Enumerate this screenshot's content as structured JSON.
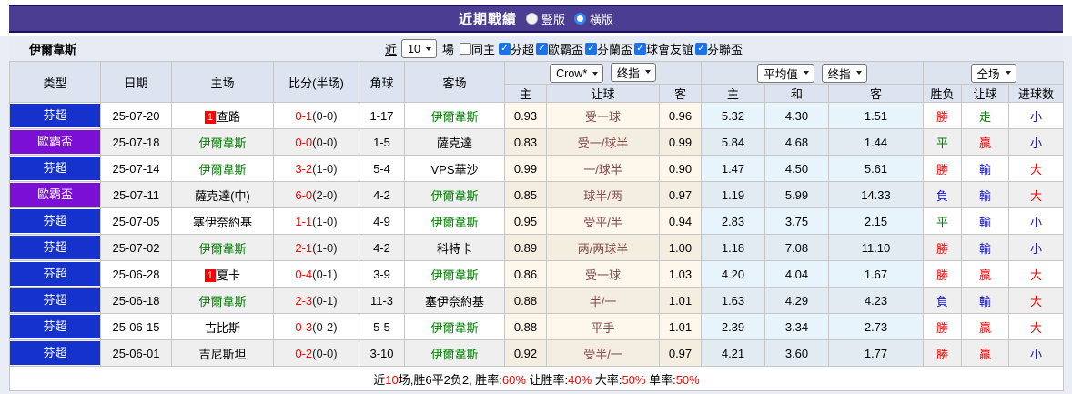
{
  "colors": {
    "accent_purple": "#4a3d92",
    "bar_border": "#1c1259",
    "league_blue": "#1532cd",
    "cup_purple": "#7c0fd6",
    "team_green": "#008000",
    "score_red": "#ff0000",
    "handicap_text": "#804a4a",
    "result_red": "#ff0000",
    "result_green": "#008000",
    "result_blue": "#1414d6",
    "odds_bg": "#fdf8eb",
    "avg_bg": "#e8f4fb",
    "header_bg": "#dde4f0",
    "filter_bg": "#e7ebf4",
    "page_bg": "#e9edf5",
    "row_alt_bg": "#efefef",
    "checkbox_blue": "#1a73e8",
    "radio_blue": "#2f81f7",
    "summary_red": "#ff0000"
  },
  "header": {
    "title": "近期戰績",
    "radio_vertical": "豎版",
    "radio_horizontal": "橫版",
    "selected": "橫版"
  },
  "filter": {
    "team": "伊爾韋斯",
    "near_label": "近",
    "match_count": "10",
    "games_label": "場",
    "same_home_label": "同主",
    "leagues": [
      "芬超",
      "歐霸盃",
      "芬蘭盃",
      "球會友誼",
      "芬聯盃"
    ]
  },
  "table": {
    "columns": {
      "type": "类型",
      "date": "日期",
      "home": "主场",
      "score": "比分(半场)",
      "corner": "角球",
      "away": "客场",
      "asian_home": "主",
      "asian_handicap": "让球",
      "asian_away": "客",
      "euro_home": "主",
      "euro_draw": "和",
      "euro_away": "客",
      "result": "胜负",
      "handicap_result": "让球",
      "goals": "进球数"
    },
    "selects": {
      "asian_company": "Crow*",
      "asian_type": "终指",
      "euro_company": "平均值",
      "euro_type": "终指",
      "scope": "全场"
    },
    "rows": [
      {
        "league": "芬超",
        "league_style": "blue",
        "date": "25-07-20",
        "home": {
          "name": "查路",
          "is_team": false,
          "redcard": "1"
        },
        "score": "0-1",
        "half": "(0-0)",
        "corner": "1-17",
        "away": {
          "name": "伊爾韋斯",
          "is_team": true
        },
        "asian": {
          "home": "0.93",
          "handicap": "受一球",
          "away": "0.96"
        },
        "euro": {
          "home": "5.32",
          "draw": "4.30",
          "away": "1.51"
        },
        "result": {
          "text": "勝",
          "color": "red"
        },
        "handicap_result": {
          "text": "走",
          "color": "green"
        },
        "goals": {
          "text": "小",
          "color": "blue"
        }
      },
      {
        "league": "歐霸盃",
        "league_style": "purple",
        "date": "25-07-18",
        "home": {
          "name": "伊爾韋斯",
          "is_team": true
        },
        "score": "0-0",
        "half": "(0-0)",
        "corner": "1-5",
        "away": {
          "name": "薩克達",
          "is_team": false
        },
        "asian": {
          "home": "0.83",
          "handicap": "受一/球半",
          "away": "0.99"
        },
        "euro": {
          "home": "5.84",
          "draw": "4.68",
          "away": "1.44"
        },
        "result": {
          "text": "平",
          "color": "green"
        },
        "handicap_result": {
          "text": "贏",
          "color": "red"
        },
        "goals": {
          "text": "小",
          "color": "blue"
        }
      },
      {
        "league": "芬超",
        "league_style": "blue",
        "date": "25-07-14",
        "home": {
          "name": "伊爾韋斯",
          "is_team": true
        },
        "score": "3-2",
        "half": "(1-0)",
        "corner": "5-4",
        "away": {
          "name": "VPS華沙",
          "is_team": false
        },
        "asian": {
          "home": "0.99",
          "handicap": "一/球半",
          "away": "0.90"
        },
        "euro": {
          "home": "1.47",
          "draw": "4.50",
          "away": "5.61"
        },
        "result": {
          "text": "勝",
          "color": "red"
        },
        "handicap_result": {
          "text": "輸",
          "color": "blue"
        },
        "goals": {
          "text": "大",
          "color": "red"
        }
      },
      {
        "league": "歐霸盃",
        "league_style": "purple",
        "date": "25-07-11",
        "home": {
          "name": "薩克達(中)",
          "is_team": false
        },
        "score": "6-0",
        "half": "(2-0)",
        "corner": "4-2",
        "away": {
          "name": "伊爾韋斯",
          "is_team": true
        },
        "asian": {
          "home": "0.85",
          "handicap": "球半/两",
          "away": "0.97"
        },
        "euro": {
          "home": "1.19",
          "draw": "5.99",
          "away": "14.33"
        },
        "result": {
          "text": "負",
          "color": "blue"
        },
        "handicap_result": {
          "text": "輸",
          "color": "blue"
        },
        "goals": {
          "text": "大",
          "color": "red"
        }
      },
      {
        "league": "芬超",
        "league_style": "blue",
        "date": "25-07-05",
        "home": {
          "name": "塞伊奈約基",
          "is_team": false
        },
        "score": "1-1",
        "half": "(1-0)",
        "corner": "4-9",
        "away": {
          "name": "伊爾韋斯",
          "is_team": true
        },
        "asian": {
          "home": "0.95",
          "handicap": "受平/半",
          "away": "0.94"
        },
        "euro": {
          "home": "2.83",
          "draw": "3.75",
          "away": "2.15"
        },
        "result": {
          "text": "平",
          "color": "green"
        },
        "handicap_result": {
          "text": "輸",
          "color": "blue"
        },
        "goals": {
          "text": "小",
          "color": "blue"
        }
      },
      {
        "league": "芬超",
        "league_style": "blue",
        "date": "25-07-02",
        "home": {
          "name": "伊爾韋斯",
          "is_team": true
        },
        "score": "2-1",
        "half": "(1-0)",
        "corner": "4-2",
        "away": {
          "name": "科特卡",
          "is_team": false
        },
        "asian": {
          "home": "0.89",
          "handicap": "两/两球半",
          "away": "1.00"
        },
        "euro": {
          "home": "1.18",
          "draw": "7.08",
          "away": "11.10"
        },
        "result": {
          "text": "勝",
          "color": "red"
        },
        "handicap_result": {
          "text": "輸",
          "color": "blue"
        },
        "goals": {
          "text": "小",
          "color": "blue"
        }
      },
      {
        "league": "芬超",
        "league_style": "blue",
        "date": "25-06-28",
        "home": {
          "name": "夏卡",
          "is_team": false,
          "redcard": "1"
        },
        "score": "0-4",
        "half": "(0-1)",
        "corner": "3-9",
        "away": {
          "name": "伊爾韋斯",
          "is_team": true
        },
        "asian": {
          "home": "0.86",
          "handicap": "受一球",
          "away": "1.03"
        },
        "euro": {
          "home": "4.20",
          "draw": "4.04",
          "away": "1.67"
        },
        "result": {
          "text": "勝",
          "color": "red"
        },
        "handicap_result": {
          "text": "贏",
          "color": "red"
        },
        "goals": {
          "text": "大",
          "color": "red"
        }
      },
      {
        "league": "芬超",
        "league_style": "blue",
        "date": "25-06-18",
        "home": {
          "name": "伊爾韋斯",
          "is_team": true
        },
        "score": "2-3",
        "half": "(0-1)",
        "corner": "11-3",
        "away": {
          "name": "塞伊奈約基",
          "is_team": false
        },
        "asian": {
          "home": "0.88",
          "handicap": "半/一",
          "away": "1.01"
        },
        "euro": {
          "home": "1.63",
          "draw": "4.29",
          "away": "4.23"
        },
        "result": {
          "text": "負",
          "color": "blue"
        },
        "handicap_result": {
          "text": "輸",
          "color": "blue"
        },
        "goals": {
          "text": "大",
          "color": "red"
        }
      },
      {
        "league": "芬超",
        "league_style": "blue",
        "date": "25-06-15",
        "home": {
          "name": "古比斯",
          "is_team": false
        },
        "score": "0-3",
        "half": "(0-2)",
        "corner": "5-5",
        "away": {
          "name": "伊爾韋斯",
          "is_team": true
        },
        "asian": {
          "home": "0.88",
          "handicap": "平手",
          "away": "1.01"
        },
        "euro": {
          "home": "2.39",
          "draw": "3.34",
          "away": "2.73"
        },
        "result": {
          "text": "勝",
          "color": "red"
        },
        "handicap_result": {
          "text": "贏",
          "color": "red"
        },
        "goals": {
          "text": "大",
          "color": "red"
        }
      },
      {
        "league": "芬超",
        "league_style": "blue",
        "date": "25-06-01",
        "home": {
          "name": "吉尼斯坦",
          "is_team": false
        },
        "score": "0-2",
        "half": "(0-0)",
        "corner": "3-10",
        "away": {
          "name": "伊爾韋斯",
          "is_team": true
        },
        "asian": {
          "home": "0.92",
          "handicap": "受半/一",
          "away": "0.97"
        },
        "euro": {
          "home": "4.21",
          "draw": "3.60",
          "away": "1.77"
        },
        "result": {
          "text": "勝",
          "color": "red"
        },
        "handicap_result": {
          "text": "贏",
          "color": "red"
        },
        "goals": {
          "text": "小",
          "color": "blue"
        }
      }
    ]
  },
  "summary": {
    "segments": [
      {
        "text": "近",
        "red": false
      },
      {
        "text": "10",
        "red": true
      },
      {
        "text": "场,胜6平2负2, 胜率:",
        "red": false
      },
      {
        "text": "60%",
        "red": true
      },
      {
        "text": " 让胜率:",
        "red": false
      },
      {
        "text": "40%",
        "red": true
      },
      {
        "text": " 大率:",
        "red": false
      },
      {
        "text": "50%",
        "red": true
      },
      {
        "text": " 单率:",
        "red": false
      },
      {
        "text": "50%",
        "red": true
      }
    ]
  }
}
